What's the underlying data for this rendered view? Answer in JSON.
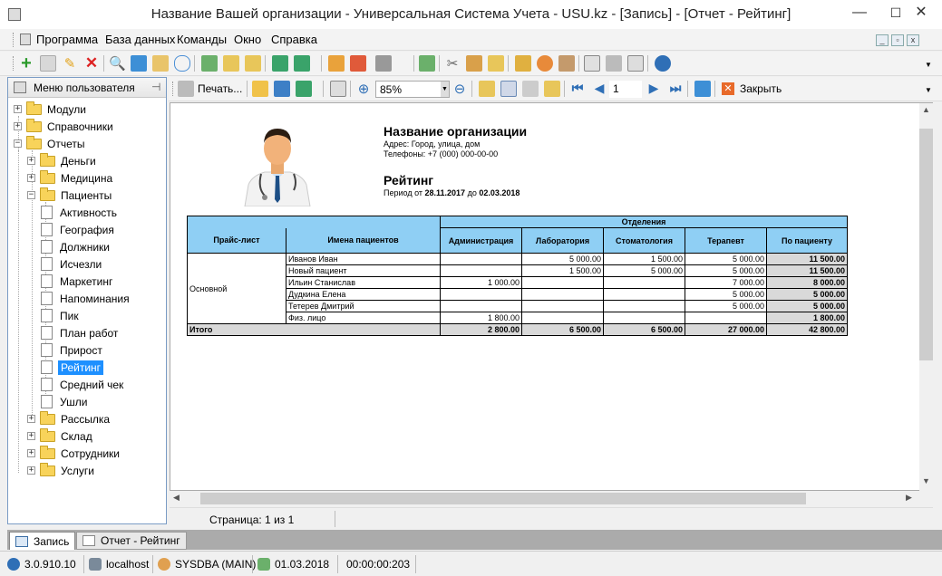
{
  "window": {
    "title": "Название Вашей организации - Универсальная Система Учета - USU.kz - [Запись] - [Отчет - Рейтинг]",
    "minimize": "—",
    "maximize": "☐",
    "close": "✕"
  },
  "menu": [
    "Программа",
    "База данных",
    "Команды",
    "Окно",
    "Справка"
  ],
  "left_panel": {
    "header": "Меню пользователя",
    "tree": [
      {
        "label": "Модули",
        "expander": "+"
      },
      {
        "label": "Справочники",
        "expander": "+"
      },
      {
        "label": "Отчеты",
        "expander": "−"
      },
      {
        "label": "Деньги",
        "expander": "+"
      },
      {
        "label": "Медицина",
        "expander": "+"
      },
      {
        "label": "Пациенты",
        "expander": "−"
      },
      {
        "label": "Активность"
      },
      {
        "label": "География"
      },
      {
        "label": "Должники"
      },
      {
        "label": "Исчезли"
      },
      {
        "label": "Маркетинг"
      },
      {
        "label": "Напоминания"
      },
      {
        "label": "Пик"
      },
      {
        "label": "План работ"
      },
      {
        "label": "Прирост"
      },
      {
        "label": "Рейтинг",
        "selected": true
      },
      {
        "label": "Средний чек"
      },
      {
        "label": "Ушли"
      },
      {
        "label": "Рассылка",
        "expander": "+"
      },
      {
        "label": "Склад",
        "expander": "+"
      },
      {
        "label": "Сотрудники",
        "expander": "+"
      },
      {
        "label": "Услуги",
        "expander": "+"
      }
    ]
  },
  "report_toolbar": {
    "print_label": "Печать...",
    "zoom": "85%",
    "page": "1",
    "close_label": "Закрыть"
  },
  "report": {
    "org_name": "Название организации",
    "address": "Адрес: Город, улица, дом",
    "phone": "Телефоны: +7 (000) 000-00-00",
    "title": "Рейтинг",
    "period_prefix": "Период от",
    "period_from": "28.11.2017",
    "period_mid": "до",
    "period_to": "02.03.2018",
    "table": {
      "group_header": "Отделения",
      "col_pricelist": "Прайс-лист",
      "col_patients": "Имена пациентов",
      "departments": [
        "Администрация",
        "Лаборатория",
        "Стоматология",
        "Терапевт"
      ],
      "col_total": "По пациенту",
      "pricelist_name": "Основной",
      "rows": [
        {
          "name": "Иванов Иван",
          "values": [
            "",
            "5 000.00",
            "1 500.00",
            "5 000.00"
          ],
          "total": "11 500.00"
        },
        {
          "name": "Новый пациент",
          "values": [
            "",
            "1 500.00",
            "5 000.00",
            "5 000.00"
          ],
          "total": "11 500.00"
        },
        {
          "name": "Ильин Станислав",
          "values": [
            "1 000.00",
            "",
            "",
            "7 000.00"
          ],
          "total": "8 000.00"
        },
        {
          "name": "Дудкина Елена",
          "values": [
            "",
            "",
            "",
            "5 000.00"
          ],
          "total": "5 000.00"
        },
        {
          "name": "Тетерев Дмитрий",
          "values": [
            "",
            "",
            "",
            "5 000.00"
          ],
          "total": "5 000.00"
        },
        {
          "name": "Физ. лицо",
          "values": [
            "1 800.00",
            "",
            "",
            ""
          ],
          "total": "1 800.00"
        }
      ],
      "total_label": "Итого",
      "totals": [
        "2 800.00",
        "6 500.00",
        "6 500.00",
        "27 000.00"
      ],
      "grand_total": "42 800.00"
    }
  },
  "page_status": "Страница: 1 из 1",
  "tabs": [
    {
      "label": "Запись",
      "active": true
    },
    {
      "label": "Отчет - Рейтинг",
      "active": false
    }
  ],
  "status_bar": {
    "version": "3.0.910.10",
    "host": "localhost",
    "user": "SYSDBA (MAIN)",
    "date": "01.03.2018",
    "timer": "00:00:00:203"
  }
}
